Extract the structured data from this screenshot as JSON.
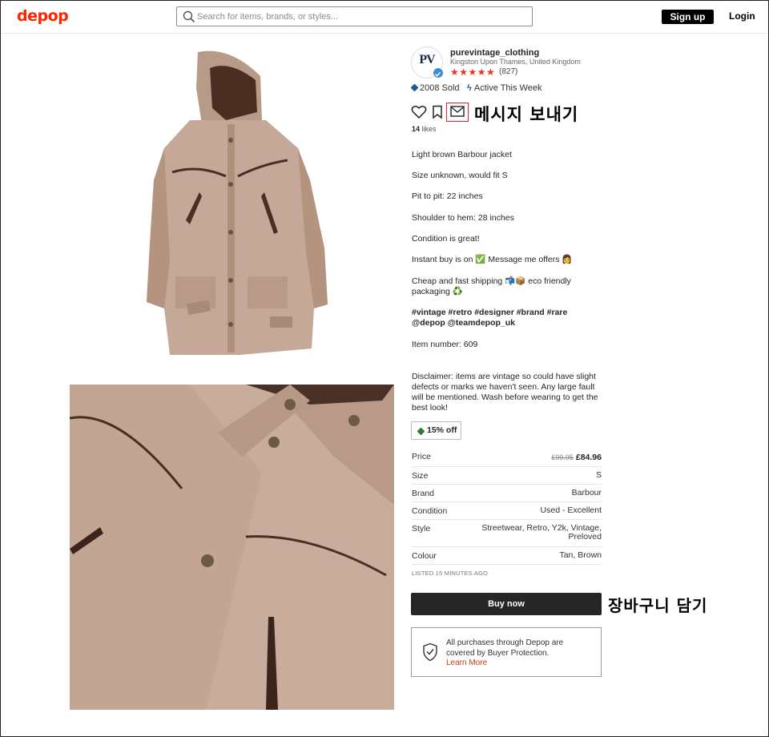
{
  "header": {
    "logo": "depop",
    "search_placeholder": "Search for items, brands, or styles...",
    "signup_label": "Sign up",
    "login_label": "Login"
  },
  "seller": {
    "avatar_monogram": "PV",
    "username": "purevintage_clothing",
    "location": "Kingston Upon Thames, United Kingdom",
    "stars": "★★★★★",
    "rating": 5,
    "review_count": "(827)",
    "sold": "2008 Sold",
    "activity": "Active This Week"
  },
  "actions": {
    "likes_count": "14",
    "likes_label": "likes",
    "message_annotation": "메시지 보내기"
  },
  "description": {
    "lines": [
      "Light brown Barbour jacket",
      "Size unknown, would fit S",
      "Pit to pit: 22 inches",
      "Shoulder to hem: 28 inches",
      "Condition is great!",
      "Instant buy is on ✅ Message me offers 👩",
      "Cheap and fast shipping 📬📦 eco friendly packaging ♻️"
    ],
    "hashtags": "#vintage #retro #designer #brand #rare @depop @teamdepop_uk",
    "item_number": "Item number: 609",
    "disclaimer": "Disclaimer: items are vintage so could have slight defects or marks we haven't seen. Any large fault will be mentioned. Wash before wearing to get the best look!"
  },
  "discount": {
    "label": "15% off"
  },
  "details": [
    {
      "key": "Price",
      "old": "£99.95",
      "new": "£84.96"
    },
    {
      "key": "Size",
      "value": "S"
    },
    {
      "key": "Brand",
      "value": "Barbour"
    },
    {
      "key": "Condition",
      "value": "Used - Excellent"
    },
    {
      "key": "Style",
      "value": "Streetwear, Retro, Y2k, Vintage, Preloved"
    },
    {
      "key": "Colour",
      "value": "Tan, Brown"
    }
  ],
  "listed": "LISTED 15 MINUTES AGO",
  "buy_label": "Buy now",
  "cart_annotation": "장바구니 담기",
  "protection": {
    "text": "All purchases through Depop are covered by Buyer Protection.",
    "link": "Learn More"
  },
  "colors": {
    "brand_red": "#ff2300",
    "star_red": "#e8341c",
    "jacket_tan": "#c5a897",
    "jacket_trim": "#4a2e22",
    "annotation_box": "#d9232d"
  }
}
